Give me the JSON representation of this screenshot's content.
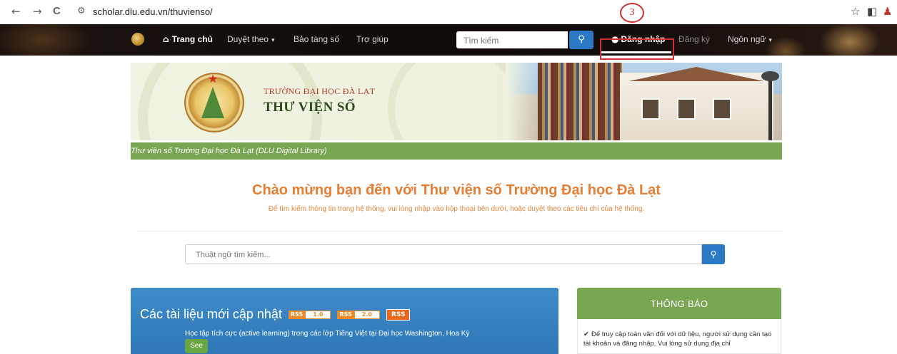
{
  "browser": {
    "url": "scholar.dlu.edu.vn/thuvienso/",
    "back_icon": "←",
    "forward_icon": "→",
    "reload_icon": "C",
    "site_info_icon": "⚙",
    "bookmark_icon": "☆",
    "sidebar_icon": "◧",
    "annotation_number": "3"
  },
  "navbar": {
    "home_label": "Trang chủ",
    "browse_label": "Duyệt theo",
    "museum_label": "Bảo tàng số",
    "help_label": "Trợ giúp",
    "search_placeholder": "Tìm kiếm",
    "search_icon": "🔍",
    "login_label": "Đăng nhập",
    "register_label": "Đăng ký",
    "language_label": "Ngôn ngữ",
    "caret": "▾",
    "home_icon": "⌂",
    "user_icon": "👤"
  },
  "banner": {
    "line1": "TRƯỜNG ĐẠI HỌC ĐÀ LẠT",
    "line2": "THƯ VIỆN SỐ",
    "subtitle": "Thư viện số Trường Đại học Đà Lạt (DLU Digital Library)"
  },
  "welcome": {
    "title": "Chào mừng bạn đến với Thư viện số Trường Đại học Đà Lạt",
    "subtitle": "Để tìm kiếm thông tin trong hệ thống, vui lòng nhập vào hộp thoại bên dưới, hoặc duyệt theo các tiêu chí của hệ thống."
  },
  "main_search": {
    "placeholder": "Thuật ngữ tìm kiếm..."
  },
  "recent": {
    "title": "Các tài liệu mới cập nhật",
    "rss1_a": "RSS",
    "rss1_b": "1.0",
    "rss2_a": "RSS",
    "rss2_b": "2.0",
    "rss3": "RSS",
    "item": "Học tập tích cực (active learning) trong các lớp Tiếng Việt tại Đại học Washington, Hoa Kỳ",
    "see_label": "See"
  },
  "notice": {
    "title": "THÔNG BÁO",
    "check_icon": "✔",
    "text": "Để truy cập toàn văn đối với dữ liệu, người sử dụng cần tạo tài khoản và đăng nhập. Vui lòng sử dụng địa chỉ"
  }
}
